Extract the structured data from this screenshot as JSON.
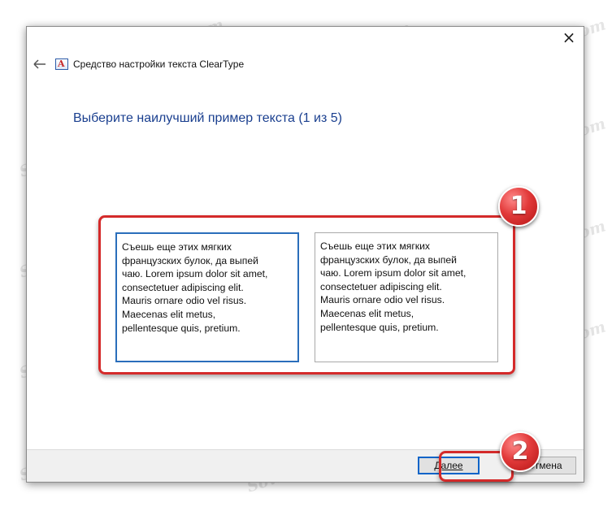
{
  "window": {
    "title": "Средство настройки текста ClearType",
    "close_glyph": "×",
    "app_icon_letter": "A"
  },
  "heading": "Выберите наилучший пример текста (1 из 5)",
  "samples": [
    {
      "lines": [
        "Съешь еще этих мягких",
        "французских булок, да выпей",
        "чаю. Lorem ipsum dolor sit amet,",
        "consectetuer adipiscing elit.",
        "Mauris ornare odio vel risus.",
        "Maecenas elit metus,",
        "pellentesque quis, pretium."
      ],
      "selected": true
    },
    {
      "lines": [
        "Съешь еще этих мягких",
        "французских булок, да выпей",
        "чаю. Lorem ipsum dolor sit amet,",
        "consectetuer adipiscing elit.",
        "Mauris ornare odio vel risus.",
        "Maecenas elit metus,",
        "pellentesque quis, pretium."
      ],
      "selected": false
    }
  ],
  "callouts": [
    "1",
    "2"
  ],
  "buttons": {
    "next": "Далее",
    "cancel": "Отмена"
  },
  "watermark_text": "Sovingsopsir.Com",
  "colors": {
    "heading": "#1a3f8f",
    "selected_border": "#2a6ebb",
    "callout_red": "#d42a2a"
  }
}
